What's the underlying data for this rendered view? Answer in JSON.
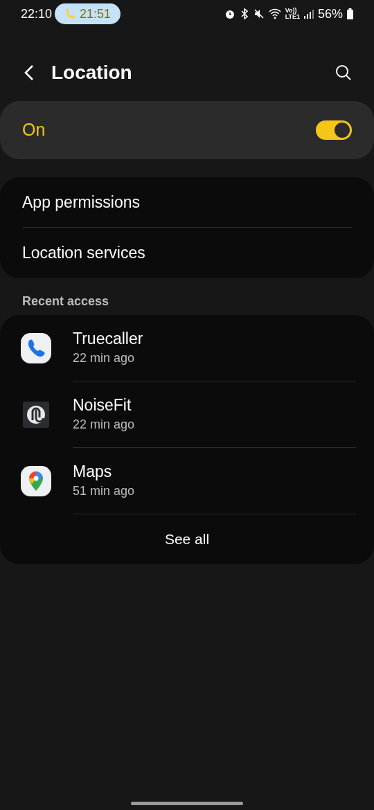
{
  "status_bar": {
    "time": "22:10",
    "call_chip": "21:51",
    "volte_top": "Vo))",
    "volte_bottom": "LTE1",
    "battery": "56%"
  },
  "header": {
    "title": "Location"
  },
  "master_switch": {
    "label": "On",
    "on": true
  },
  "menu": [
    {
      "label": "App permissions"
    },
    {
      "label": "Location services"
    }
  ],
  "recent_access": {
    "heading": "Recent access",
    "apps": [
      {
        "kind": "phone",
        "name": "Truecaller",
        "time": "22 min ago"
      },
      {
        "kind": "noise",
        "name": "NoiseFit",
        "time": "22 min ago"
      },
      {
        "kind": "pin",
        "name": "Maps",
        "time": "51 min ago"
      }
    ],
    "see_all": "See all"
  }
}
